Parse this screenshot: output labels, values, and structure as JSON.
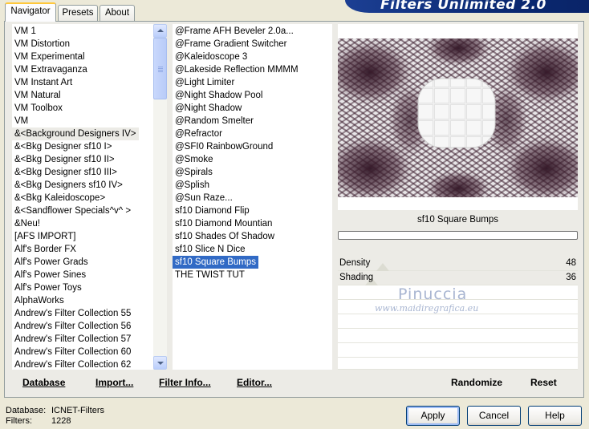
{
  "banner": {
    "title": "Filters Unlimited 2.0"
  },
  "tabs": [
    {
      "label": "Navigator",
      "active": true
    },
    {
      "label": "Presets",
      "active": false
    },
    {
      "label": "About",
      "active": false
    }
  ],
  "categories": {
    "items": [
      "VM 1",
      "VM Distortion",
      "VM Experimental",
      "VM Extravaganza",
      "VM Instant Art",
      "VM Natural",
      "VM Toolbox",
      "VM",
      "&<Background Designers IV>",
      "&<Bkg Designer sf10 I>",
      "&<Bkg Designer sf10 II>",
      "&<Bkg Designer sf10 III>",
      "&<Bkg Designers sf10 IV>",
      "&<Bkg Kaleidoscope>",
      "&<Sandflower Specials^v^ >",
      "&Neu!",
      "[AFS IMPORT]",
      "Alf's Border FX",
      "Alf's Power Grads",
      "Alf's Power Sines",
      "Alf's Power Toys",
      "AlphaWorks",
      "Andrew's Filter Collection 55",
      "Andrew's Filter Collection 56",
      "Andrew's Filter Collection 57",
      "Andrew's Filter Collection 60",
      "Andrew's Filter Collection 62"
    ],
    "highlighted_index": 8
  },
  "filters": {
    "items": [
      "@Frame AFH Beveler 2.0a...",
      "@Frame Gradient Switcher",
      "@Kaleidoscope 3",
      "@Lakeside Reflection MMMM",
      "@Light Limiter",
      "@Night Shadow Pool",
      "@Night Shadow",
      "@Random Smelter",
      "@Refractor",
      "@SFI0 RainbowGround",
      "@Smoke",
      "@Spirals",
      "@Splish",
      "@Sun Raze...",
      "sf10 Diamond Flip",
      "sf10 Diamond Mountian",
      "sf10 Shades Of Shadow",
      "sf10 Slice N Dice",
      "sf10 Square Bumps",
      "THE TWIST TUT"
    ],
    "selected_index": 18
  },
  "left_buttons": {
    "database": "Database",
    "import": "Import...",
    "filter_info": "Filter Info...",
    "editor": "Editor..."
  },
  "preview": {
    "filter_name": "sf10 Square Bumps",
    "progress": 0
  },
  "params": [
    {
      "label": "Density",
      "value": "48",
      "level": 0.188
    },
    {
      "label": "Shading",
      "value": "36",
      "level": 0.141
    }
  ],
  "right_buttons": {
    "randomize": "Randomize",
    "reset": "Reset"
  },
  "watermark": {
    "line1": "Pinuccia",
    "line2": "www.maidiregrafica.eu"
  },
  "status": {
    "database_label": "Database:",
    "database_value": "ICNET-Filters",
    "filters_label": "Filters:",
    "filters_value": "1228"
  },
  "dialog_buttons": {
    "apply": "Apply",
    "cancel": "Cancel",
    "help": "Help"
  },
  "colors": {
    "selection": "#316ac5",
    "pattern_dark": "#3a1b2c",
    "banner": "#0b2a74"
  }
}
